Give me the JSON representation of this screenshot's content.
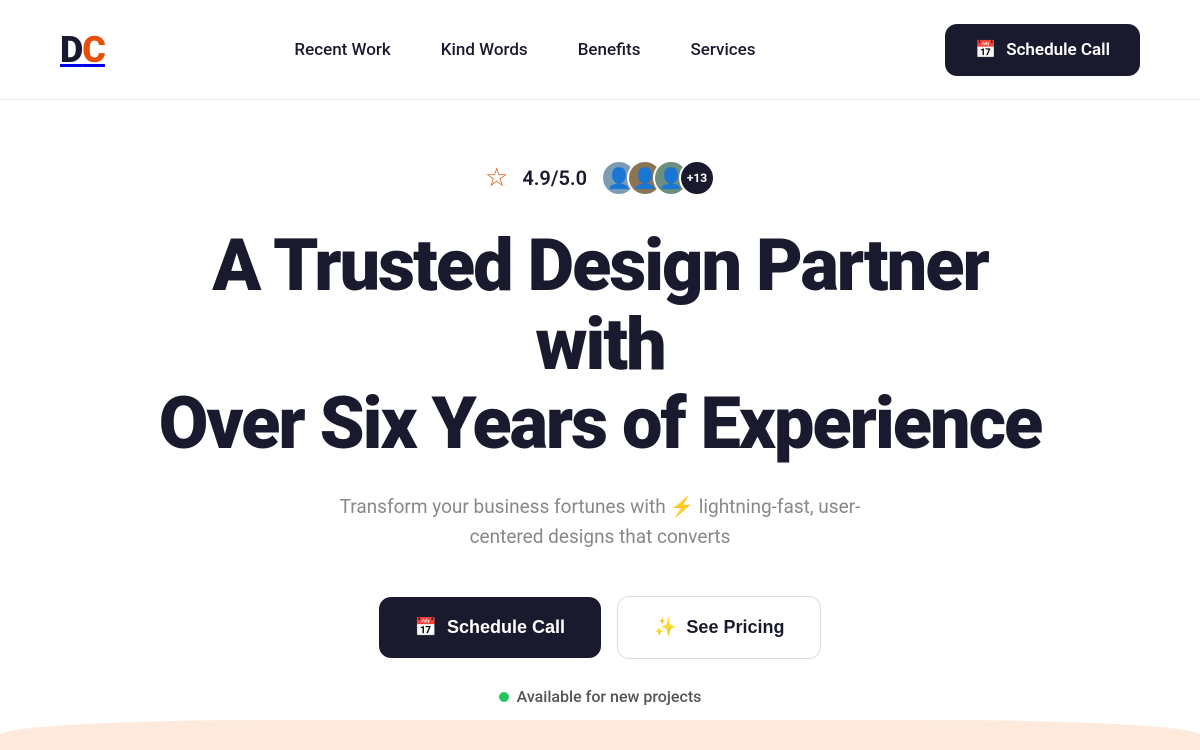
{
  "logo": {
    "letter_d": "D",
    "letter_c": "C"
  },
  "nav": {
    "links": [
      {
        "id": "recent-work",
        "label": "Recent Work"
      },
      {
        "id": "kind-words",
        "label": "Kind Words"
      },
      {
        "id": "benefits",
        "label": "Benefits"
      },
      {
        "id": "services",
        "label": "Services"
      }
    ],
    "cta": {
      "label": "Schedule Call",
      "icon": "📅"
    }
  },
  "hero": {
    "rating": {
      "star_icon": "☆",
      "score": "4.9/5.0",
      "avatar_count_label": "+13"
    },
    "title_line1": "A Trusted Design Partner with",
    "title_line2": "Over Six Years of Experience",
    "subtitle": "Transform your business fortunes with ⚡ lightning-fast, user-centered designs that converts",
    "cta_primary": {
      "label": "Schedule Call",
      "icon": "📅"
    },
    "cta_secondary": {
      "label": "See Pricing",
      "icon": "✨"
    },
    "availability": "Available for new projects"
  }
}
